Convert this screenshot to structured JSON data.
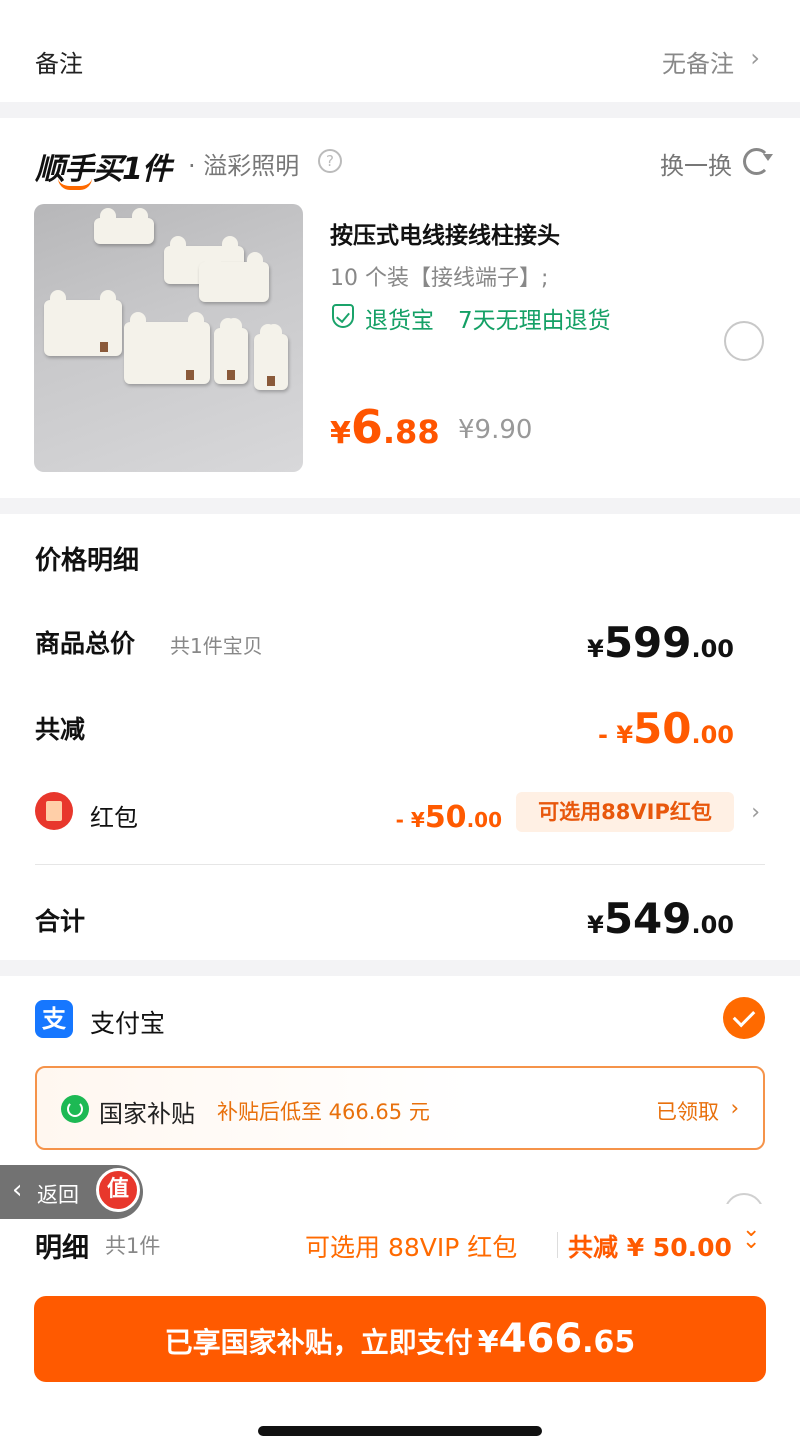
{
  "remark": {
    "label": "备注",
    "value": "无备注",
    "chevron": "›"
  },
  "bundle": {
    "brand": "顺手买1件",
    "subtitle": "· 溢彩照明",
    "help_icon": "?",
    "swap_label": "换一换",
    "product": {
      "title": "按压式电线接线柱接头",
      "spec": "10 个装【接线端子】;",
      "return_badge": "退货宝",
      "return_text": "7天无理由退货",
      "price_currency": "¥",
      "price_int": "6",
      "price_dec": ".88",
      "original_price": "¥9.90"
    }
  },
  "price_detail": {
    "title": "价格明细",
    "goods_total": {
      "label": "商品总价",
      "sub": "共1件宝贝",
      "currency": "¥",
      "int": "599",
      "dec": ".00"
    },
    "discount": {
      "label": "共减",
      "currency": "- ¥",
      "int": "50",
      "dec": ".00"
    },
    "redpack": {
      "label": "红包",
      "currency": "- ¥",
      "int": "50",
      "dec": ".00",
      "tag": "可选用88VIP红包",
      "chevron": "›"
    },
    "total": {
      "label": "合计",
      "currency": "¥",
      "int": "549",
      "dec": ".00"
    }
  },
  "payment": {
    "alipay_icon": "支",
    "alipay_label": "支付宝",
    "subsidy": {
      "title": "国家补贴",
      "desc": "补贴后低至 466.65 元",
      "status": "已领取",
      "chevron": "›"
    }
  },
  "floating_back": {
    "chevron": "‹",
    "label": "返回",
    "badge": "值"
  },
  "bottom_bar": {
    "detail_label": "明细",
    "detail_count": "共1件",
    "vip_hint": "可选用 88VIP 红包",
    "total_discount": "共减 ¥ 50.00",
    "expand_icon": "⌄",
    "pay_button": {
      "text": "已享国家补贴，立即支付",
      "currency": "¥",
      "int": "466",
      "dec": ".65"
    }
  },
  "colors": {
    "accent": "#ff5a00",
    "green": "#14a065",
    "alipay": "#1677ff",
    "red": "#e8372c"
  }
}
